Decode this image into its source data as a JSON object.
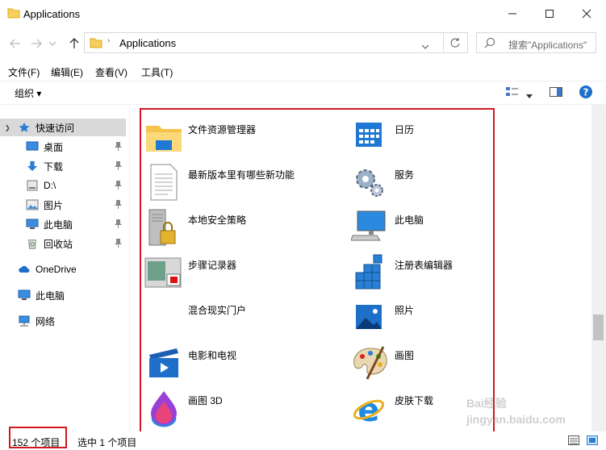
{
  "window": {
    "title": "Applications"
  },
  "address": {
    "path": "Applications",
    "search_placeholder": "搜索\"Applications\""
  },
  "menu": [
    "文件(F)",
    "编辑(E)",
    "查看(V)",
    "工具(T)"
  ],
  "toolbar": {
    "organize": "组织 ▾"
  },
  "nav": {
    "quick_access": "快速访问",
    "items": [
      "桌面",
      "下载",
      "D:\\",
      "图片",
      "此电脑",
      "回收站"
    ],
    "onedrive": "OneDrive",
    "this_pc": "此电脑",
    "network": "网络"
  },
  "files": {
    "left": [
      "文件资源管理器",
      "最新版本里有哪些新功能",
      "本地安全策略",
      "步骤记录器",
      "混合现实门户",
      "电影和电视",
      "画图 3D"
    ],
    "right": [
      "日历",
      "服务",
      "此电脑",
      "注册表编辑器",
      "照片",
      "画图",
      "皮肤下载"
    ]
  },
  "status": {
    "count": "152 个项目",
    "selected": "选中 1 个项目"
  },
  "watermark": "Bai经验 jingyan.baidu.com"
}
